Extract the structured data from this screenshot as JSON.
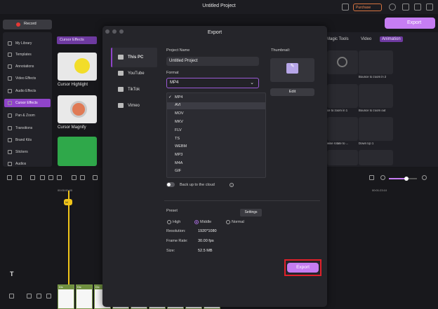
{
  "app": {
    "title": "Untitled Project",
    "purchase": "Purchase",
    "record": "Record",
    "export": "Export"
  },
  "sidebar": {
    "items": [
      {
        "label": "My Library"
      },
      {
        "label": "Templates"
      },
      {
        "label": "Annotations"
      },
      {
        "label": "Video Effects"
      },
      {
        "label": "Audio Effects"
      },
      {
        "label": "Cursor Effects"
      },
      {
        "label": "Pan & Zoom"
      },
      {
        "label": "Transitions"
      },
      {
        "label": "Brand Kits"
      },
      {
        "label": "Stickers"
      },
      {
        "label": "Audios"
      }
    ]
  },
  "library": {
    "tab": "Cursor Effects",
    "items": [
      {
        "label": "Cursor Highlight"
      },
      {
        "label": "Cursor Magnify"
      }
    ]
  },
  "right_panel": {
    "tabs": [
      "Magic Tools",
      "Video",
      "Animation"
    ],
    "cells": [
      {
        "label": ""
      },
      {
        "label": "Bounce to zoom in 2"
      },
      {
        "label": "ce to zoom in 1"
      },
      {
        "label": "Bounce to zoom out"
      },
      {
        "label": "wise rotate to ..."
      },
      {
        "label": "Down Up 1"
      }
    ]
  },
  "timeline": {
    "ruler_start": "00:00:00:00",
    "ruler_end": "00:01:23:10",
    "track_label": "T",
    "clip_label": "Dic"
  },
  "dialog": {
    "title": "Export",
    "nav": [
      {
        "label": "This PC"
      },
      {
        "label": "YouTube"
      },
      {
        "label": "TikTok"
      },
      {
        "label": "Vimeo"
      }
    ],
    "project_name_label": "Project Name",
    "project_name": "Untitled Project",
    "format_label": "Format",
    "format_value": "MP4",
    "format_options": [
      "MP4",
      "AVI",
      "MOV",
      "MKV",
      "FLV",
      "TS",
      "WEBM",
      "MP3",
      "M4A",
      "GIF"
    ],
    "thumbnail_label": "Thumbnail:",
    "edit": "Edit",
    "cloud_label": "Back up to the cloud",
    "preset_label": "Preset",
    "settings": "Settings",
    "presets": [
      "High",
      "Middle",
      "Normal"
    ],
    "resolution_label": "Resolution:",
    "resolution": "1920*1080",
    "framerate_label": "Frame Rate:",
    "framerate": "30.00 fps",
    "size_label": "Size:",
    "size": "52.5 MB",
    "export": "Export"
  }
}
